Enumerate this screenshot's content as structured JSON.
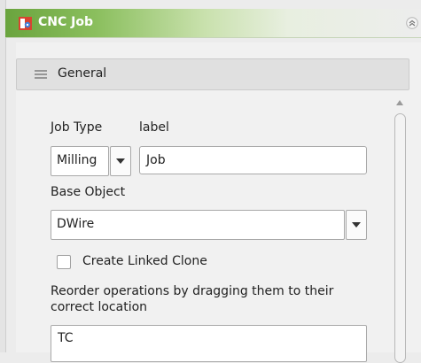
{
  "window": {
    "title": "CNC Job",
    "icon": "freecad-path-icon",
    "collapse_icon": "double-chevron-up-icon"
  },
  "section": {
    "label": "General",
    "icon": "list-lines-icon"
  },
  "job_type": {
    "label": "Job Type",
    "selected": "Milling"
  },
  "job_label": {
    "label": "label",
    "value": "Job"
  },
  "base_object": {
    "label": "Base Object",
    "selected": "DWire"
  },
  "linked_clone": {
    "label": "Create Linked Clone",
    "checked": false
  },
  "operations": {
    "instruction": "Reorder operations by dragging them to their correct location",
    "items": [
      "TC"
    ]
  },
  "colors": {
    "titlebar_green": "#6aa43e",
    "background": "#ececec"
  }
}
